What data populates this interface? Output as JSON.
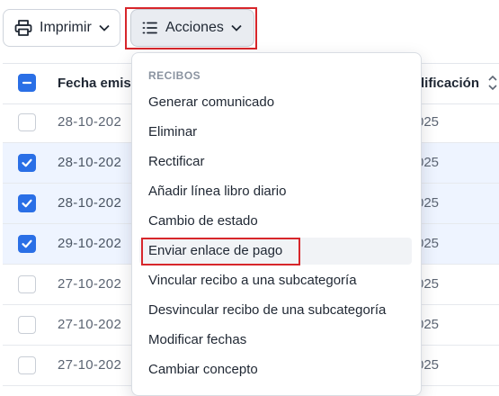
{
  "toolbar": {
    "print_label": "Imprimir",
    "actions_label": "Acciones"
  },
  "table": {
    "headers": {
      "date": "Fecha emis",
      "modified": "dificación"
    },
    "rows": [
      {
        "date": "28-10-202",
        "modified": "025",
        "checked": false
      },
      {
        "date": "28-10-202",
        "modified": "025",
        "checked": true
      },
      {
        "date": "28-10-202",
        "modified": "025",
        "checked": true
      },
      {
        "date": "29-10-202",
        "modified": "025",
        "checked": true
      },
      {
        "date": "27-10-202",
        "modified": "025",
        "checked": false
      },
      {
        "date": "27-10-202",
        "modified": "025",
        "checked": false
      },
      {
        "date": "27-10-202",
        "modified": "025",
        "checked": false
      }
    ]
  },
  "dropdown": {
    "section_label": "RECIBOS",
    "items": [
      "Generar comunicado",
      "Eliminar",
      "Rectificar",
      "Añadir línea libro diario",
      "Cambio de estado",
      "Enviar enlace de pago",
      "Vincular recibo a una subcategoría",
      "Desvincular recibo de una subcategoría",
      "Modificar fechas",
      "Cambiar concepto"
    ],
    "highlighted_index": 5
  },
  "colors": {
    "accent": "#2a6fe6",
    "highlight_box": "#d7262b",
    "selected_row": "#eef4ff"
  }
}
